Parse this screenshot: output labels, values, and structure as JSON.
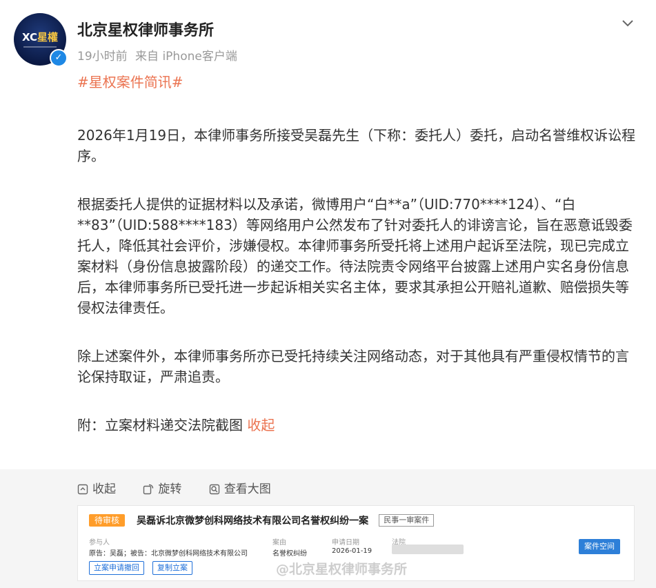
{
  "author": {
    "name": "北京星权律师事务所",
    "avatar_text_left": "XC",
    "avatar_text_right": "星權"
  },
  "meta": {
    "time": "19小时前",
    "source": "来自 iPhone客户端"
  },
  "hashtag": "#星权案件简讯#",
  "paragraphs": [
    "2026年1月19日，本律师事务所接受吴磊先生（下称：委托人）委托，启动名誉维权诉讼程序。",
    "根据委托人提供的证据材料以及承诺，微博用户“白**a”（UID:770****124）、“白**83”（UID:588****183）等网络用户公然发布了针对委托人的诽谤言论，旨在恶意诋毁委托人，降低其社会评价，涉嫌侵权。本律师事务所受托将上述用户起诉至法院，现已完成立案材料（身份信息披露阶段）的递交工作。待法院责令网络平台披露上述用户实名身份信息后，本律师事务所已受托进一步起诉相关实名主体，要求其承担公开赔礼道歉、赔偿损失等侵权法律责任。",
    "除上述案件外，本律师事务所亦已受托持续关注网络动态，对于其他具有严重侵权情节的言论保持取证，严肃追责。"
  ],
  "attachment": {
    "text": "附：立案材料递交法院截图",
    "collapse_link": "收起"
  },
  "tools": {
    "collapse": "收起",
    "rotate": "旋转",
    "view_large": "查看大图"
  },
  "case_card": {
    "status": "待审核",
    "title": "吴磊诉北京微梦创科网络技术有限公司名誉权纠纷一案",
    "tag": "民事一审案件",
    "party_label": "参与人",
    "party_value": "原告：吴磊；被告：北京微梦创科网络技术有限公司",
    "cause_label": "案由",
    "cause_value": "名誉权纠纷",
    "date_label": "申请日期",
    "date_value": "2026-01-19",
    "court_label": "法院",
    "btn_withdraw": "立案申请撤回",
    "btn_copy": "复制立案",
    "btn_space": "案件空间",
    "watermark": "@北京星权律师事务所"
  },
  "colors": {
    "accent": "#eb7350",
    "blue": "#2d7fd8",
    "pending": "#ff9d2a"
  },
  "icons": [
    "verified-badge-icon",
    "chevron-down-icon",
    "collapse-icon",
    "rotate-icon",
    "view-large-icon"
  ]
}
